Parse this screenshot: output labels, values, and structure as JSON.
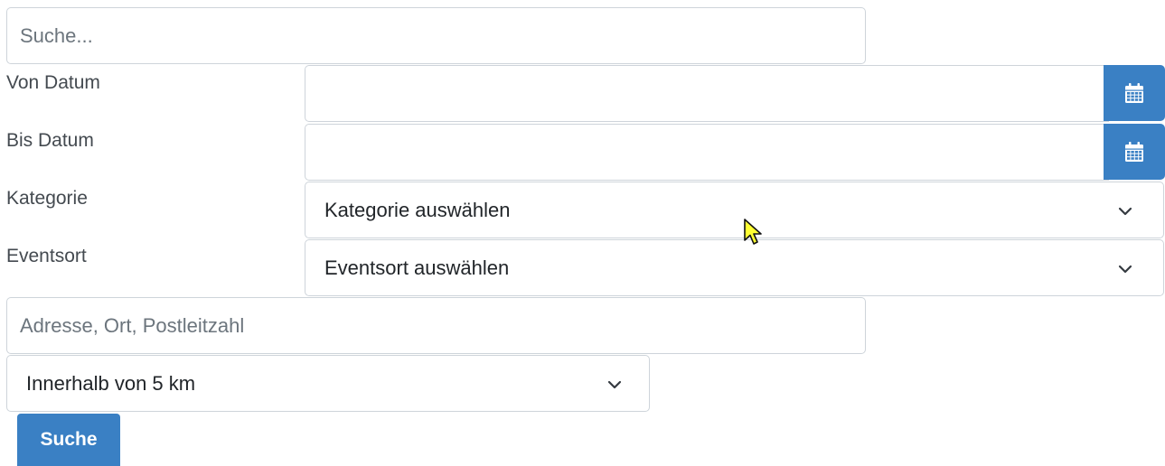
{
  "search": {
    "placeholder": "Suche..."
  },
  "from_date": {
    "label": "Von Datum",
    "value": ""
  },
  "to_date": {
    "label": "Bis Datum",
    "value": ""
  },
  "category": {
    "label": "Kategorie",
    "selected": "Kategorie auswählen"
  },
  "event_location": {
    "label": "Eventsort",
    "selected": "Eventsort auswählen"
  },
  "address": {
    "placeholder": "Adresse, Ort, Postleitzahl"
  },
  "radius": {
    "selected": "Innerhalb von 5 km"
  },
  "submit": {
    "label": "Suche"
  },
  "colors": {
    "accent": "#3a80c4",
    "border": "#ced4da",
    "placeholder": "#6c757d",
    "cursor": "#ffff33"
  },
  "icons": {
    "calendar": "calendar-icon",
    "chevron": "chevron-down-icon",
    "cursor": "mouse-cursor-icon"
  }
}
